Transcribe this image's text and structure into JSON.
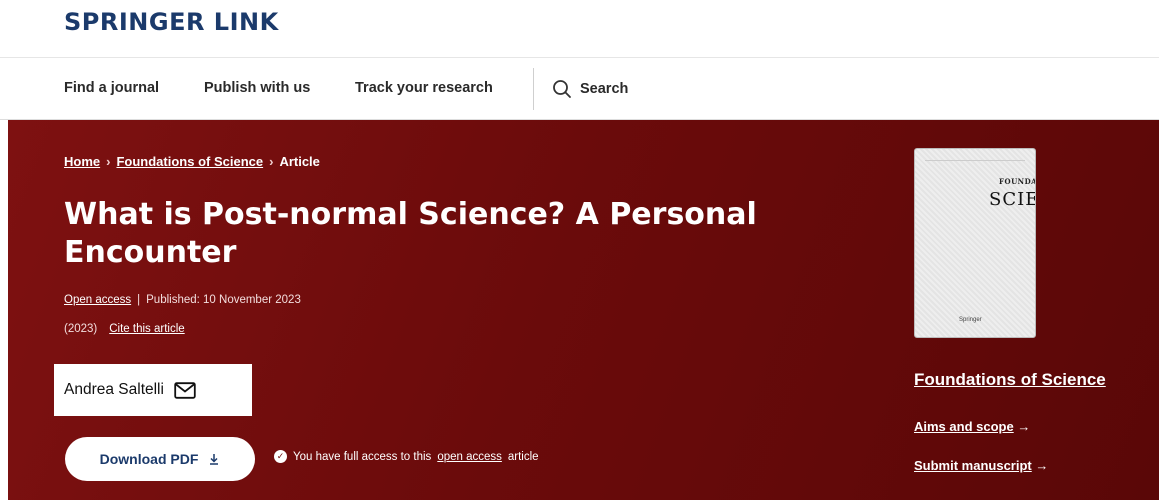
{
  "brand": {
    "logo_text": "SPRINGER LINK"
  },
  "nav": {
    "links": [
      "Find a journal",
      "Publish with us",
      "Track your research"
    ],
    "search_label": "Search"
  },
  "breadcrumb": {
    "items": [
      "Home",
      "Foundations of Science",
      "Article"
    ],
    "separator": "›"
  },
  "article": {
    "title": "What is Post-normal Science? A Personal Encounter",
    "open_access": "Open access",
    "pipe": "|",
    "published": "Published: 10 November 2023",
    "year": "(2023)",
    "cite": "Cite this article",
    "author": "Andrea Saltelli",
    "download_label": "Download PDF",
    "access_prefix": "You have full access to this",
    "access_link": "open access",
    "access_suffix": "article"
  },
  "sidebar": {
    "cover_title_small": "FOUNDATIONS",
    "cover_title_big": "SCIENCE",
    "cover_publisher": "Springer",
    "journal_name": "Foundations of Science",
    "aims_label": "Aims and scope",
    "submit_label": "Submit manuscript",
    "arrow": "→"
  },
  "colors": {
    "brand_navy": "#1b3a6b",
    "hero_maroon": "#6b0b0b"
  }
}
